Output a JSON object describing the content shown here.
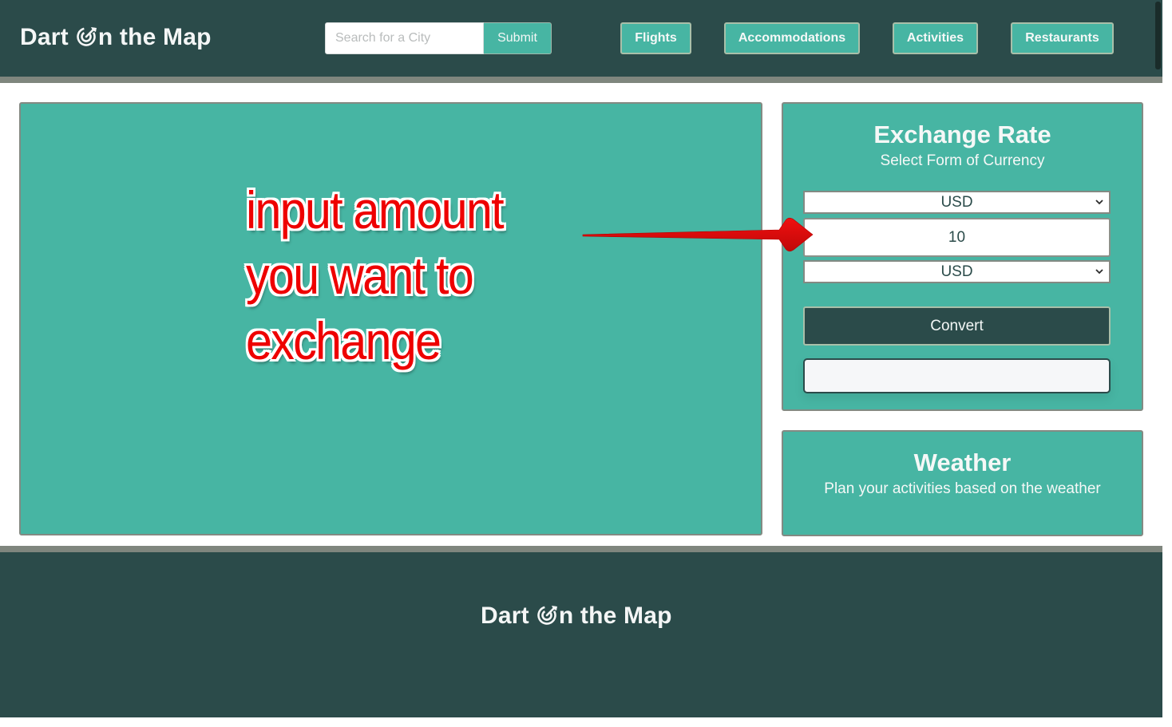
{
  "header": {
    "brand_prefix": "Dart ",
    "brand_suffix": "n the Map",
    "brand_icon": "dart-target-icon",
    "search": {
      "placeholder": "Search for a City",
      "value": ""
    },
    "submit_label": "Submit",
    "nav": [
      {
        "label": "Flights"
      },
      {
        "label": "Accommodations"
      },
      {
        "label": "Activities"
      },
      {
        "label": "Restaurants"
      }
    ]
  },
  "exchange": {
    "title": "Exchange Rate",
    "subtitle": "Select Form of Currency",
    "from_currency": "USD",
    "amount": "10",
    "to_currency": "USD",
    "convert_label": "Convert",
    "result": ""
  },
  "weather": {
    "title": "Weather",
    "subtitle": "Plan your activities based on the weather"
  },
  "footer": {
    "brand_prefix": "Dart ",
    "brand_suffix": "n the Map"
  },
  "annotation": {
    "lines": [
      "input amount",
      "you want to",
      "exchange"
    ],
    "color": "#ee0000",
    "arrow_icon": "arrow-right-icon"
  },
  "colors": {
    "header_bg": "#2b4b4a",
    "accent_teal": "#47b5a3",
    "rule_gray": "#7f867e"
  }
}
